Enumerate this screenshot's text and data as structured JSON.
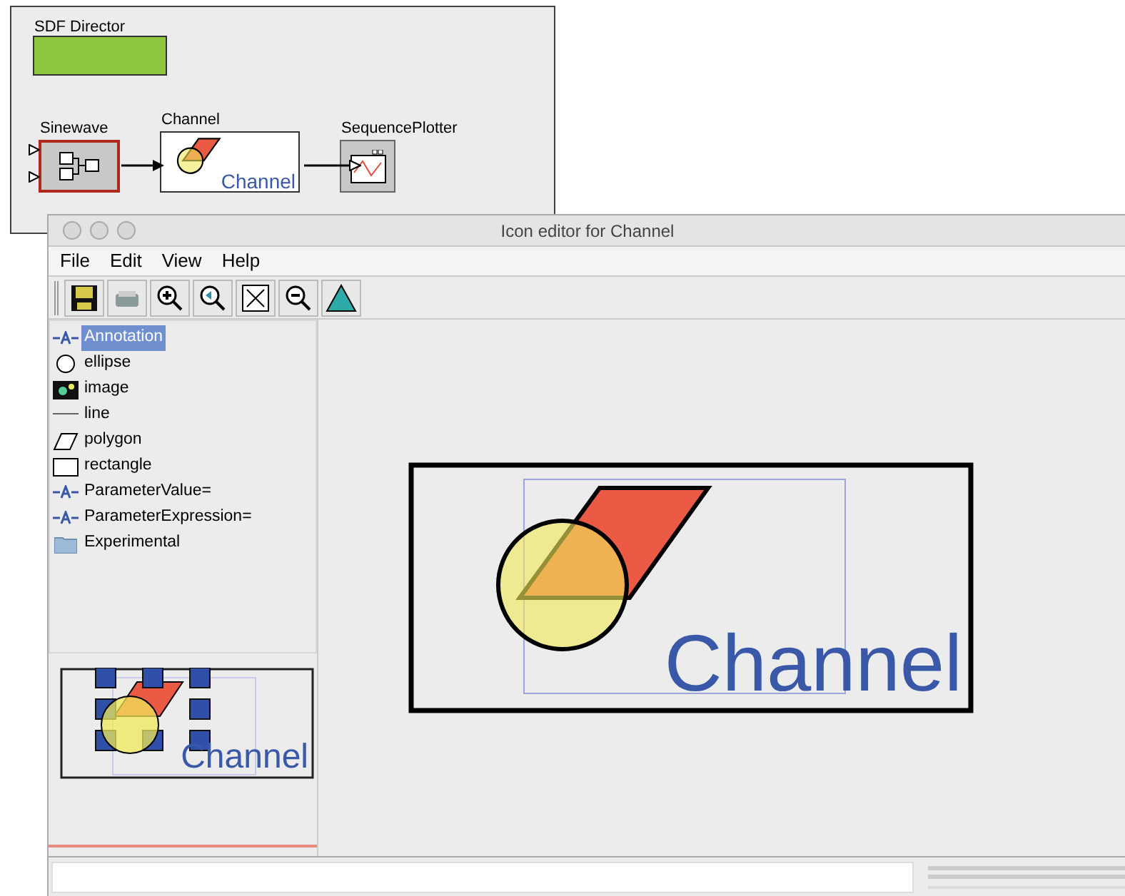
{
  "model_window": {
    "director": {
      "label": "SDF Director"
    },
    "actors": [
      {
        "kind": "source",
        "label": "Sinewave",
        "selected": true
      },
      {
        "kind": "composite",
        "label": "Channel",
        "icon_text": "Channel",
        "selected": false
      },
      {
        "kind": "plotter",
        "label": "SequencePlotter",
        "selected": false
      }
    ]
  },
  "editor": {
    "title": "Icon editor for Channel",
    "menus": [
      "File",
      "Edit",
      "View",
      "Help"
    ],
    "library": [
      {
        "kind": "annotation",
        "label": "Annotation",
        "selected": true
      },
      {
        "kind": "ellipse",
        "label": "ellipse",
        "selected": false
      },
      {
        "kind": "image",
        "label": "image",
        "selected": false
      },
      {
        "kind": "line",
        "label": "line",
        "selected": false
      },
      {
        "kind": "polygon",
        "label": "polygon",
        "selected": false
      },
      {
        "kind": "rectangle",
        "label": "rectangle",
        "selected": false
      },
      {
        "kind": "annotation",
        "label": "ParameterValue=",
        "selected": false
      },
      {
        "kind": "annotation",
        "label": "ParameterExpression=",
        "selected": false
      },
      {
        "kind": "folder",
        "label": "Experimental",
        "selected": false
      }
    ],
    "preview_text": "Channel",
    "canvas_text": "Channel"
  }
}
